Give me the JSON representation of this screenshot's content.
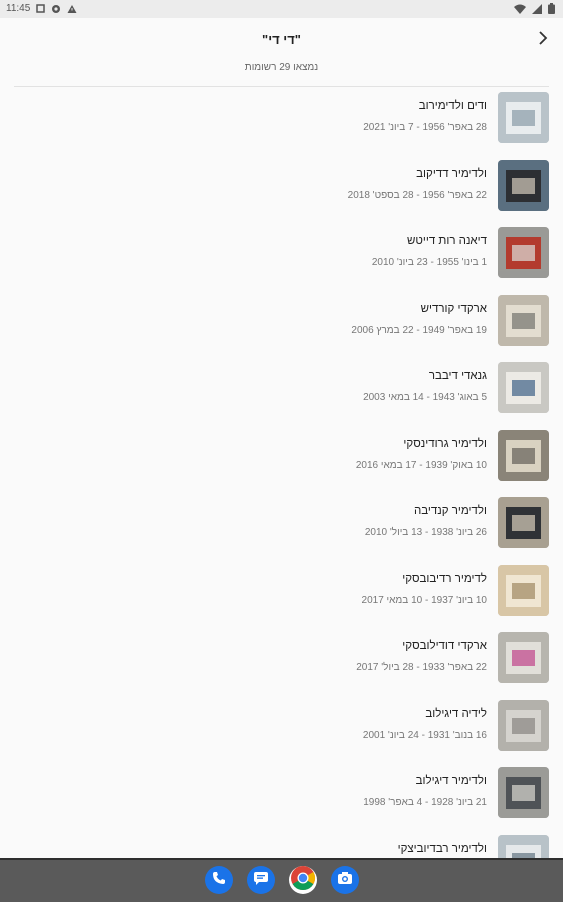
{
  "status_bar": {
    "time": "11:45"
  },
  "header": {
    "title": "\"די די\"",
    "subtitle": "נמצאו 29 רשומות"
  },
  "records": [
    {
      "name": "ודים ולדימירוב",
      "dates": "28 באפר' 1956 - 7 ביונ' 2021",
      "thumb": [
        "#b9c3c9",
        "#e8ecee",
        "#8fa0ab"
      ]
    },
    {
      "name": "ולדימיר דדיקוב",
      "dates": "22 באפר' 1956 - 28 בספט' 2018",
      "thumb": [
        "#5a6f80",
        "#2d2f33",
        "#c9c2b4"
      ]
    },
    {
      "name": "דיאנה רות דייטש",
      "dates": "1 בינו' 1955 - 23 ביונ' 2010",
      "thumb": [
        "#9a9a96",
        "#b33b2e",
        "#d8d6d0"
      ]
    },
    {
      "name": "ארקדי קורדיש",
      "dates": "19 באפר' 1949 - 22 במרץ 2006",
      "thumb": [
        "#bfb8ab",
        "#e3ddd0",
        "#7b7a74"
      ]
    },
    {
      "name": "גנאדי דיבבר",
      "dates": "5 באוג' 1943 - 14 במאי 2003",
      "thumb": [
        "#c9c8c3",
        "#eceae5",
        "#4a6a8c"
      ]
    },
    {
      "name": "ולדימיר גרודינסקי",
      "dates": "10 באוק' 1939 - 17 במאי 2016",
      "thumb": [
        "#8a8478",
        "#d9d2c1",
        "#6b675f"
      ]
    },
    {
      "name": "ולדימיר קנדיבה",
      "dates": "26 ביונ' 1938 - 13 ביול' 2010",
      "thumb": [
        "#a8a091",
        "#2f3236",
        "#cfc6b4"
      ]
    },
    {
      "name": "לדימיר רדיבובסקי",
      "dates": "10 ביונ' 1937 - 10 במאי 2017",
      "thumb": [
        "#d8c6a6",
        "#f0e6d2",
        "#a48d68"
      ]
    },
    {
      "name": "ארקדי דודילובסקי",
      "dates": "22 באפר' 1933 - 28 ביול' 2017",
      "thumb": [
        "#b7b5ae",
        "#e1dfd9",
        "#c24d8f"
      ]
    },
    {
      "name": "לידיה דיגילוב",
      "dates": "16 בנוב' 1931 - 24 ביונ' 2001",
      "thumb": [
        "#b3b1ab",
        "#d5d3ce",
        "#8c8a85"
      ]
    },
    {
      "name": "ולדימיר דיגילוב",
      "dates": "21 ביונ' 1928 - 4 באפר' 1998",
      "thumb": [
        "#9b9b97",
        "#4f5357",
        "#d2d0c9"
      ]
    },
    {
      "name": "ולדימיר רבדיוביצקי",
      "dates": "",
      "thumb": [
        "#b8c2c8",
        "#e5e8ea",
        "#6a7c88"
      ]
    }
  ],
  "nav_apps": [
    {
      "name": "phone",
      "color": "#1a73e8"
    },
    {
      "name": "messages",
      "color": "#1a73e8"
    },
    {
      "name": "chrome",
      "color": "#ffffff"
    },
    {
      "name": "camera",
      "color": "#1a73e8"
    }
  ]
}
